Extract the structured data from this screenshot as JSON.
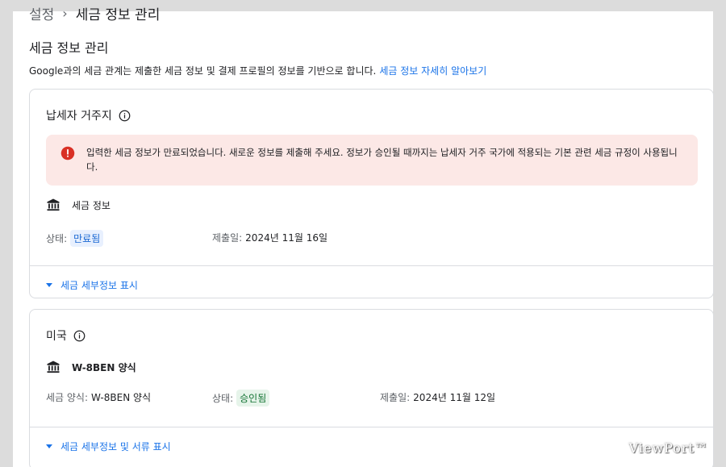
{
  "breadcrumb": {
    "parent": "설정",
    "separator": "›",
    "current": "세금 정보 관리"
  },
  "page_title": "세금 정보 관리",
  "intro": {
    "text": "Google과의 세금 관계는 제출한 세금 정보 및 결제 프로필의 정보를 기반으로 합니다.",
    "link": "세금 정보 자세히 알아보기"
  },
  "card_residence": {
    "title": "납세자 거주지",
    "alert": "입력한 세금 정보가 만료되었습니다. 새로운 정보를 제출해 주세요. 정보가 승인될 때까지는 납세자 거주 국가에 적용되는 기본 관련 세금 규정이 사용됩니다.",
    "form_name": "세금 정보",
    "status_label": "상태:",
    "status_value": "만료됨",
    "submitted_label": "제출일:",
    "submitted_value": "2024년 11월 16일",
    "expander": "세금 세부정보 표시"
  },
  "card_us": {
    "title": "미국",
    "form_name": "W-8BEN 양식",
    "form_type_label": "세금 양식:",
    "form_type_value": "W-8BEN 양식",
    "status_label": "상태:",
    "status_value": "승인됨",
    "submitted_label": "제출일:",
    "submitted_value": "2024년 11월 12일",
    "expander": "세금 세부정보 및 서류 표시"
  },
  "watermark": "ViewPort™",
  "colors": {
    "link": "#1a73e8",
    "alert_bg": "#fce8e6",
    "alert_icon": "#d93025",
    "expired_chip_bg": "#e8f0fe",
    "approved_chip_bg": "#e6f4ea"
  }
}
